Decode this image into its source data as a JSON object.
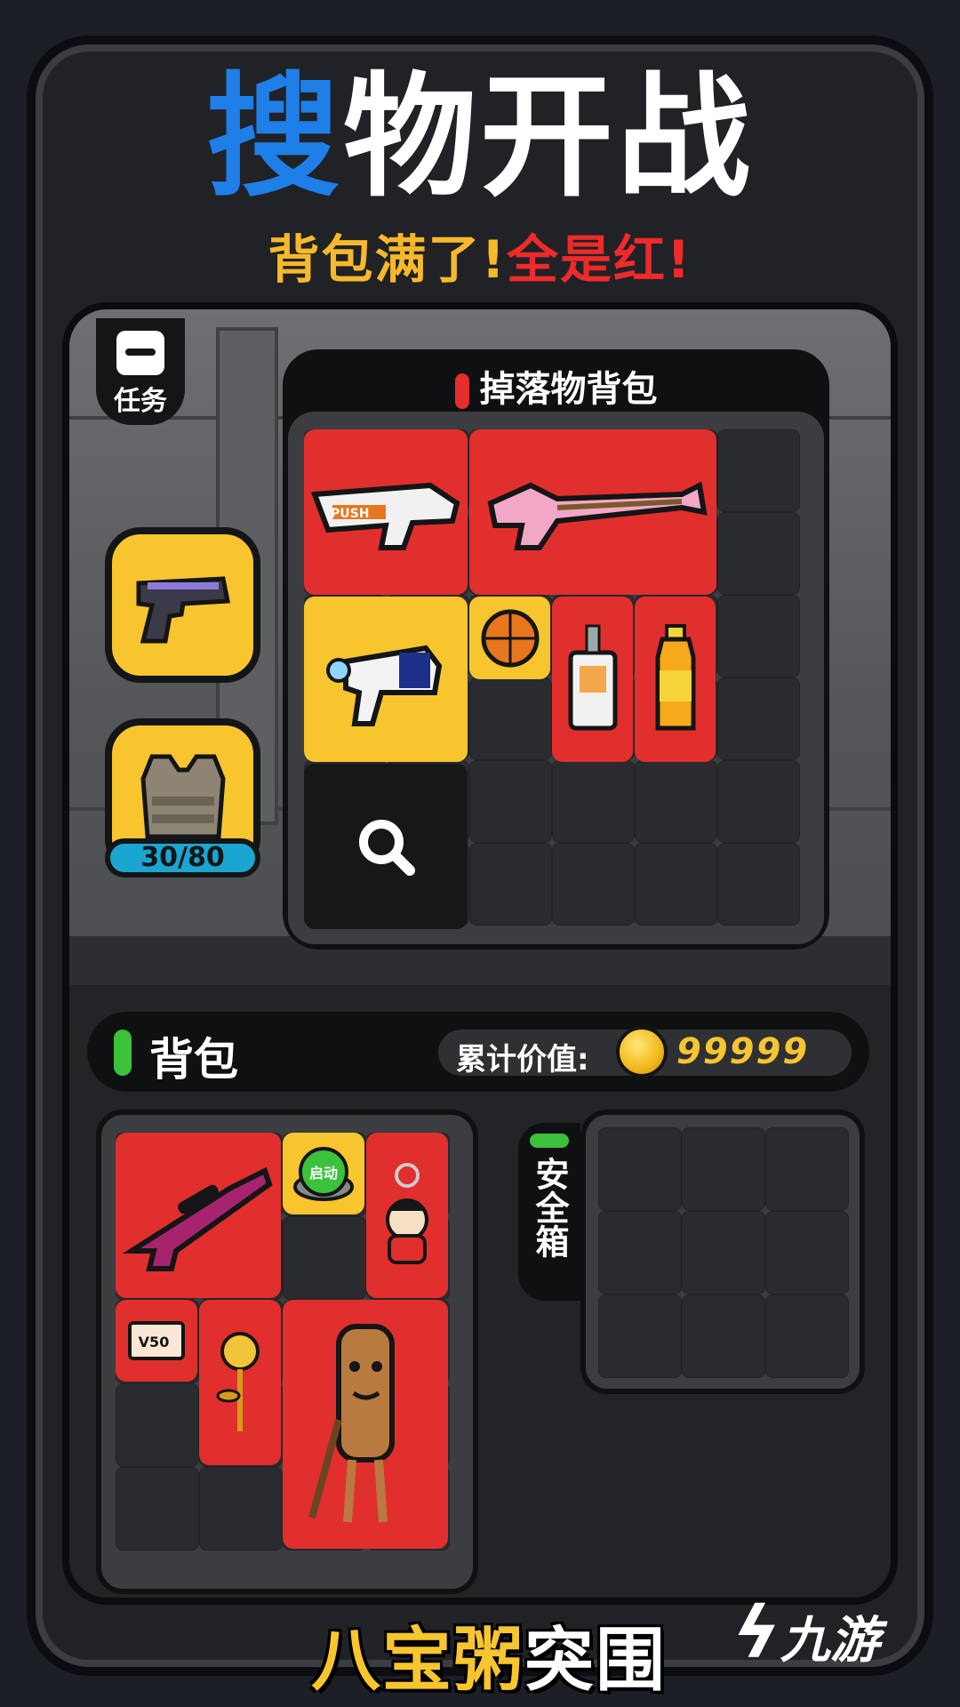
{
  "headline": {
    "blue_char": "搜",
    "rest": "物开战"
  },
  "subline": {
    "part1": "背包满了!",
    "part2": "全是红!"
  },
  "task": {
    "label": "任务"
  },
  "equipment": {
    "capacity": "30/80"
  },
  "loot_bag": {
    "title": "掉落物背包"
  },
  "backpack": {
    "title": "背包",
    "value_label": "累计价值:",
    "value": "99999"
  },
  "safe_box": {
    "label": "安全箱"
  },
  "items": {
    "push_label": "PUSH",
    "button_label": "启动",
    "ticket_label": "V50"
  },
  "footer": {
    "logo_yellow": "八宝粥",
    "logo_white": "突围",
    "watermark": "九游"
  },
  "colors": {
    "accent_blue": "#1f7fe8",
    "tile_red": "#e12f2d",
    "tile_yellow": "#f7c52e",
    "green": "#3cc13a",
    "gold": "#f7c52e"
  }
}
